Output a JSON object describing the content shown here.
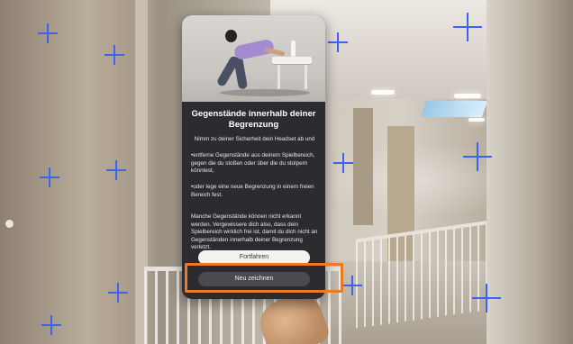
{
  "dialog": {
    "title": "Gegenstände innerhalb deiner Begrenzung",
    "intro": "Nimm zu deiner Sicherheit dein Headset ab und",
    "bullet_1": "•entferne Gegenstände aus deinem Spielbereich, gegen die du stoßen oder über die du stolpern könntest,",
    "bullet_2": "•oder lege eine neue Begrenzung in einem freien Bereich fest.",
    "warning": "Manche Gegenstände können nicht erkannt werden. Vergewissere dich also, dass dein Spielbereich wirklich frei ist, damit du dich nicht an Gegenständen innerhalb deiner Begrenzung verletzt.",
    "continue_label": "Fortfahren",
    "redraw_label": "Neu zeichnen"
  },
  "colors": {
    "boundary_marker": "#3d63f2",
    "highlight": "#ec7a25",
    "dialog_bg": "#2c2c30"
  },
  "icons": [
    "boundary-marker-icon"
  ]
}
